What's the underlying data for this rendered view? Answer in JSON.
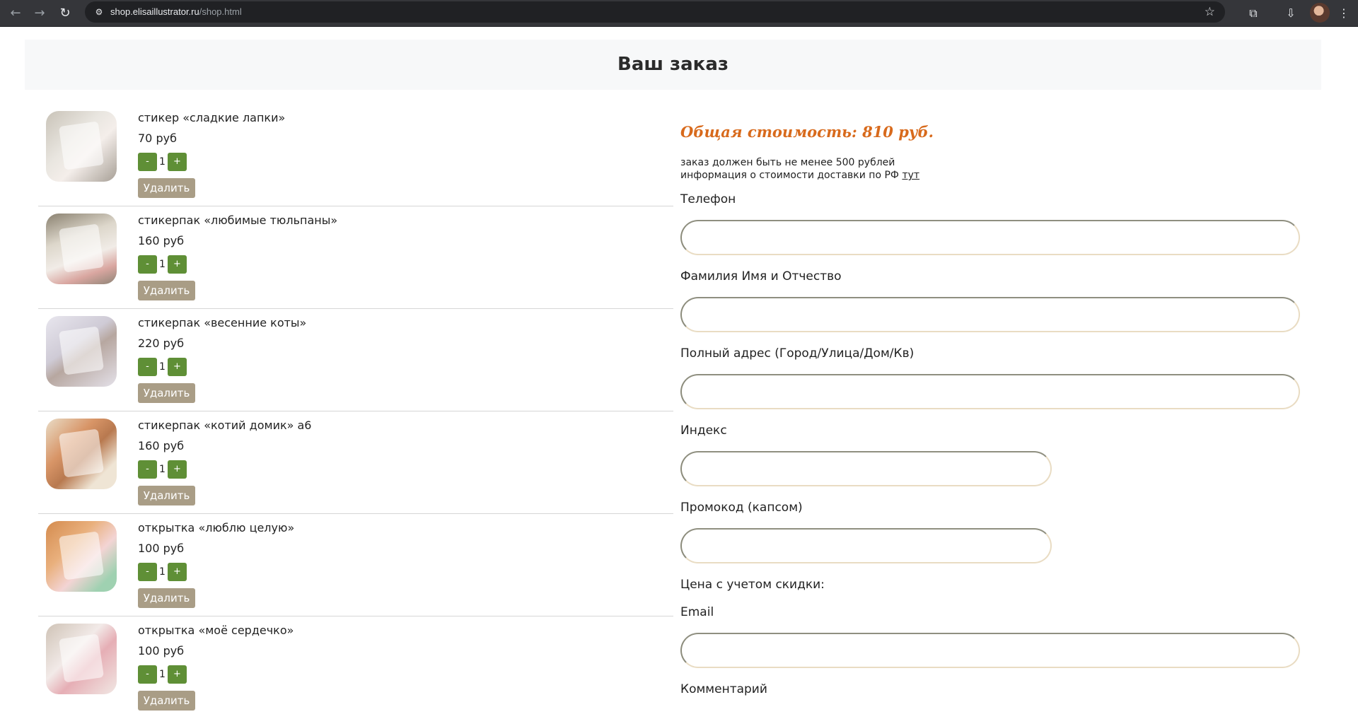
{
  "browser": {
    "url_host": "shop.elisaillustrator.ru",
    "url_path": "/shop.html",
    "icons": [
      "back-icon",
      "forward-icon",
      "reload-icon",
      "site-info-icon",
      "bookmark-star-icon",
      "extensions-icon",
      "download-icon",
      "profile-avatar",
      "menu-icon"
    ]
  },
  "header": {
    "title": "Ваш заказ"
  },
  "cart": {
    "items": [
      {
        "name": "стикер «сладкие лапки»",
        "price": "70 руб",
        "qty": "1",
        "minus": "-",
        "plus": "+",
        "remove": "Удалить"
      },
      {
        "name": "стикерпак «любимые тюльпаны»",
        "price": "160 руб",
        "qty": "1",
        "minus": "-",
        "plus": "+",
        "remove": "Удалить"
      },
      {
        "name": "стикерпак «весенние коты»",
        "price": "220 руб",
        "qty": "1",
        "minus": "-",
        "plus": "+",
        "remove": "Удалить"
      },
      {
        "name": "стикерпак «котий домик» а6",
        "price": "160 руб",
        "qty": "1",
        "minus": "-",
        "plus": "+",
        "remove": "Удалить"
      },
      {
        "name": "открытка «люблю целую»",
        "price": "100 руб",
        "qty": "1",
        "minus": "-",
        "plus": "+",
        "remove": "Удалить"
      },
      {
        "name": "открытка «моё сердечко»",
        "price": "100 руб",
        "qty": "1",
        "minus": "-",
        "plus": "+",
        "remove": "Удалить"
      }
    ]
  },
  "order": {
    "total": "Общая стоимость: 810 руб.",
    "min_note": "заказ должен быть не менее 500 рублей",
    "delivery_note": "информация о стоимости доставки по РФ",
    "delivery_link": "тут",
    "phone_label": "Телефон",
    "name_label": "Фамилия Имя и Отчество",
    "address_label": "Полный адрес (Город/Улица/Дом/Кв)",
    "index_label": "Индекс",
    "promo_label": "Промокод (капсом)",
    "discount_label": "Цена с учетом скидки:",
    "email_label": "Email",
    "comment_label": "Комментарий"
  },
  "colors": {
    "accent_orange": "#d86a1c",
    "qty_button_green": "#5f8f36",
    "remove_button_taupe": "#a99d86"
  }
}
